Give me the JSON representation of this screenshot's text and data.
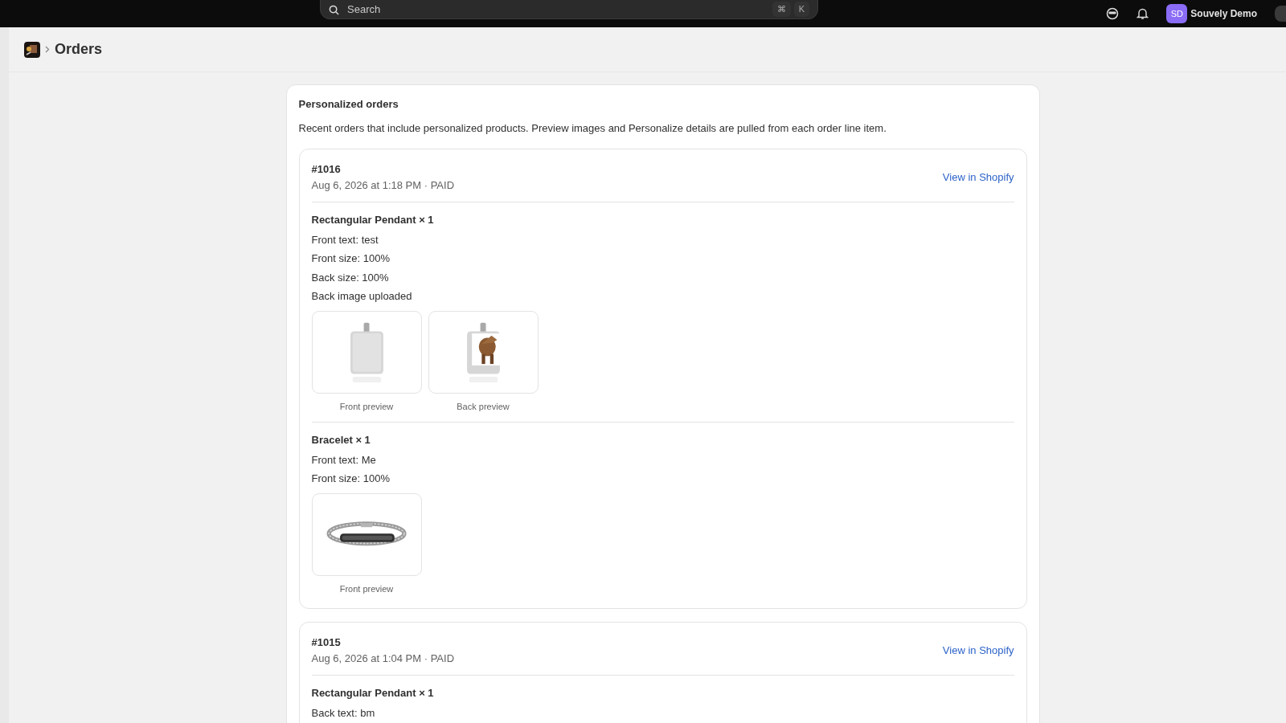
{
  "topbar": {
    "search": {
      "placeholder": "Search",
      "shortcut_keys": [
        "⌘",
        "K"
      ]
    },
    "user": {
      "initials": "SD",
      "name": "Souvely Demo"
    }
  },
  "breadcrumb": {
    "page_title": "Orders"
  },
  "section": {
    "title": "Personalized orders",
    "description": "Recent orders that include personalized products. Preview images and Personalize details are pulled from each order line item."
  },
  "orders": [
    {
      "number": "#1016",
      "meta": "Aug 6, 2026 at 1:18 PM · PAID",
      "link": "View in Shopify",
      "items": [
        {
          "title": "Rectangular Pendant × 1",
          "details": [
            "Front text: test",
            "Front size: 100%",
            "Back size: 100%",
            "Back image uploaded"
          ],
          "previews": [
            {
              "kind": "pendant",
              "label": "Front preview"
            },
            {
              "kind": "pendant-photo",
              "label": "Back preview"
            }
          ]
        },
        {
          "title": "Bracelet × 1",
          "details": [
            "Front text: Me",
            "Front size: 100%"
          ],
          "previews": [
            {
              "kind": "bracelet",
              "label": "Front preview"
            }
          ]
        }
      ]
    },
    {
      "number": "#1015",
      "meta": "Aug 6, 2026 at 1:04 PM · PAID",
      "link": "View in Shopify",
      "items": [
        {
          "title": "Rectangular Pendant × 1",
          "details": [
            "Back text: bm"
          ]
        }
      ]
    }
  ]
}
